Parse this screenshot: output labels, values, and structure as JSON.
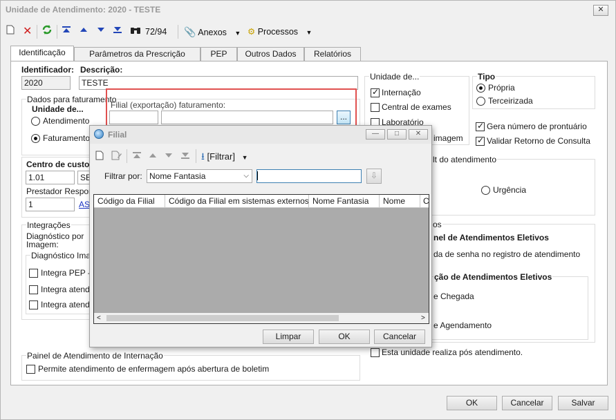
{
  "window": {
    "title": "Unidade de Atendimento: 2020 - TESTE",
    "close": "✕"
  },
  "toolbar": {
    "record_counter": "72/94",
    "anexos": "Anexos",
    "processos": "Processos"
  },
  "tabs": [
    "Identificação",
    "Parâmetros da Prescrição",
    "PEP",
    "Outros Dados",
    "Relatórios"
  ],
  "form": {
    "identificador_label": "Identificador:",
    "identificador_value": "2020",
    "descricao_label": "Descrição:",
    "descricao_value": "TESTE",
    "dados_faturamento_label": "Dados para faturamento",
    "unidade_de_label": "Unidade de...",
    "atendimento_label": "Atendimento",
    "faturamento_label": "Faturamento",
    "filial_label": "Filial (exportação) faturamento:",
    "centro_custos_label": "Centro de custos",
    "centro_custos_value": "1.01",
    "centro_custos_desc": "SE",
    "prestador_label": "Prestador Respons",
    "prestador_value": "1",
    "prestador_link": "AS",
    "integracoes_label": "Integrações",
    "diag_imagem_label_1": "Diagnóstico por",
    "diag_imagem_label_2": "Imagem:",
    "diag_imagem_group": "Diagnóstico Image",
    "integra_1": "Integra PEP - I",
    "integra_2": "Integra atend",
    "integra_3": "Integra atend",
    "painel_internacao_label": "Painel de Atendimento de Internação",
    "permite_enfermagem": "Permite atendimento de enfermagem após abertura de boletim"
  },
  "right": {
    "unidade_de_label": "Unidade de...",
    "internacao": "Internação",
    "central_exames": "Central de exames",
    "laboratorio": "Laboratório",
    "imagem_partial": "imagem",
    "tipo_label": "Tipo",
    "propria": "Própria",
    "terceirizada": "Terceirizada",
    "gera_prontuario": "Gera número de prontuário",
    "validar_retorno": "Validar Retorno de Consulta",
    "default_atendimento": "lt do atendimento",
    "urgencia": "Urgência",
    "os_partial": "os",
    "painel_eletivos": "nel de Atendimentos Eletivos",
    "senha_registro": "da de senha no registro de atendimento",
    "ordenacao_eletivos": "ção de Atendimentos Eletivos",
    "chegada": "e Chegada",
    "agendamento": "e Agendamento",
    "realiza_pos": "Esta unidade realiza pós atendimento."
  },
  "footer": {
    "ok": "OK",
    "cancelar": "Cancelar",
    "salvar": "Salvar"
  },
  "dialog": {
    "title": "Filial",
    "filtrar_menu": "[Filtrar]",
    "filtrar_por_label": "Filtrar por:",
    "filtrar_por_value": "Nome Fantasia",
    "search_value": "",
    "columns": [
      "Código da Filial",
      "Código da Filial em sistemas externos",
      "Nome Fantasia",
      "Nome",
      "C"
    ],
    "limpar": "Limpar",
    "ok": "OK",
    "cancelar": "Cancelar",
    "browse": "..."
  }
}
